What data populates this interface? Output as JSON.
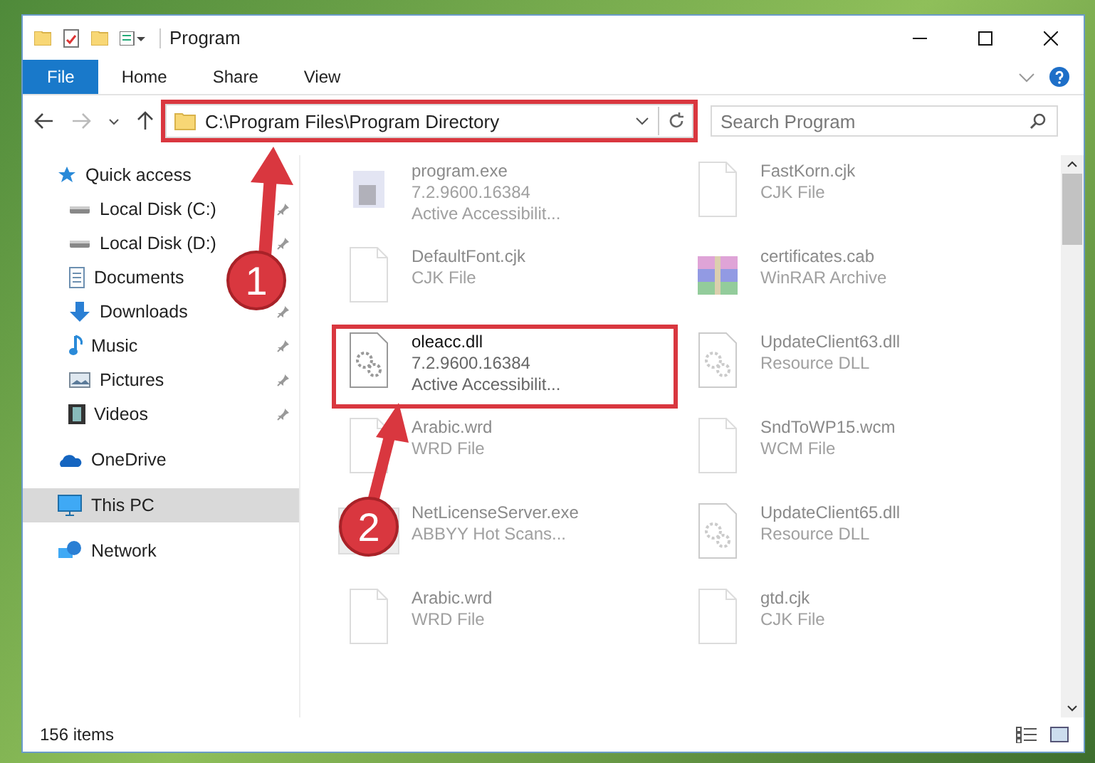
{
  "window": {
    "title": "Program"
  },
  "ribbon_tabs": [
    {
      "label": "File",
      "kind": "file"
    },
    {
      "label": "Home",
      "kind": "tab"
    },
    {
      "label": "Share",
      "kind": "tab"
    },
    {
      "label": "View",
      "kind": "tab"
    }
  ],
  "address_bar": {
    "path": "C:\\Program Files\\Program Directory",
    "highlighted": true
  },
  "search": {
    "placeholder": "Search Program"
  },
  "sidebar": {
    "items": [
      {
        "label": "Quick access",
        "kind": "star",
        "selected": false,
        "children": [
          {
            "label": "Local Disk (C:)",
            "kind": "disk",
            "pinned": true,
            "selected": false
          },
          {
            "label": "Local Disk (D:)",
            "kind": "disk",
            "pinned": true,
            "selected": false
          },
          {
            "label": "Documents",
            "kind": "documents",
            "selected": false
          },
          {
            "label": "Downloads",
            "kind": "downloads",
            "pinned": true,
            "selected": false
          },
          {
            "label": "Music",
            "kind": "music",
            "pinned": true,
            "selected": false
          },
          {
            "label": "Pictures",
            "kind": "pictures",
            "pinned": true,
            "selected": false
          },
          {
            "label": "Videos",
            "kind": "videos",
            "pinned": true,
            "selected": false
          }
        ]
      },
      {
        "label": "OneDrive",
        "kind": "cloud",
        "selected": false
      },
      {
        "label": "This PC",
        "kind": "pc",
        "selected": true
      },
      {
        "label": "Network",
        "kind": "network",
        "selected": false
      }
    ]
  },
  "files": [
    {
      "name": "program.exe",
      "details": [
        "7.2.9600.16384",
        "Active Accessibilit..."
      ],
      "kind": "exe",
      "faded": true
    },
    {
      "name": "FastKorn.cjk",
      "details": [
        "CJK File"
      ],
      "kind": "doc",
      "faded": true
    },
    {
      "name": "DefaultFont.cjk",
      "details": [
        "CJK File"
      ],
      "kind": "doc",
      "faded": true
    },
    {
      "name": "certificates.cab",
      "details": [
        "WinRAR Archive"
      ],
      "kind": "archive",
      "faded": true
    },
    {
      "name": "oleacc.dll",
      "details": [
        "7.2.9600.16384",
        "Active Accessibilit..."
      ],
      "kind": "dll",
      "faded": false,
      "highlighted": true
    },
    {
      "name": "UpdateClient63.dll",
      "details": [
        "Resource DLL"
      ],
      "kind": "dll",
      "faded": true
    },
    {
      "name": "Arabic.wrd",
      "details": [
        "WRD File"
      ],
      "kind": "doc",
      "faded": true
    },
    {
      "name": "SndToWP15.wcm",
      "details": [
        "WCM File"
      ],
      "kind": "doc",
      "faded": true
    },
    {
      "name": "NetLicenseServer.exe",
      "details": [
        "ABBYY Hot Scans..."
      ],
      "kind": "app",
      "faded": true
    },
    {
      "name": "UpdateClient65.dll",
      "details": [
        "Resource DLL"
      ],
      "kind": "dll",
      "faded": true
    },
    {
      "name": "Arabic.wrd",
      "details": [
        "WRD File"
      ],
      "kind": "doc",
      "faded": true
    },
    {
      "name": "gtd.cjk",
      "details": [
        "CJK File"
      ],
      "kind": "doc",
      "faded": true
    }
  ],
  "status_bar": {
    "count": "156 items"
  },
  "annotations": [
    {
      "number": "1"
    },
    {
      "number": "2"
    }
  ]
}
